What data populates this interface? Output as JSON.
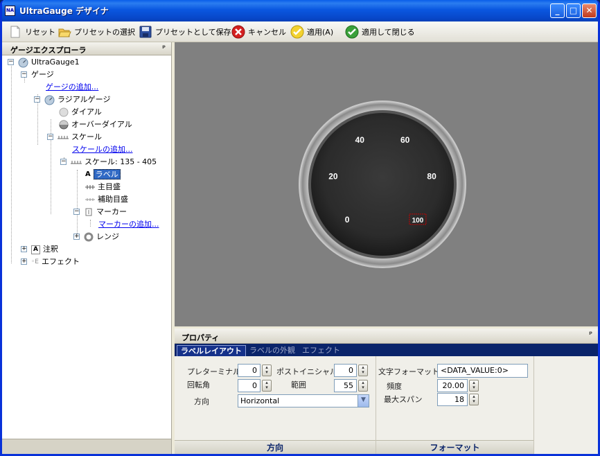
{
  "window": {
    "title": "UltraGauge デザイナ",
    "app_icon_text": "NA",
    "minimize": "_",
    "maximize": "□",
    "close": "✕"
  },
  "toolbar": {
    "reset": "リセット",
    "select_preset": "プリセットの選択",
    "save_as_preset": "プリセットとして保存",
    "cancel": "キャンセル",
    "apply": "適用(A)",
    "apply_close": "適用して閉じる"
  },
  "explorer": {
    "title": "ゲージエクスプローラ",
    "pin": "ᵖ",
    "nodes": {
      "root": "UltraGauge1",
      "gauges": "ゲージ",
      "add_gauge": "ゲージの追加...",
      "radial_gauge": "ラジアルゲージ",
      "dial": "ダイアル",
      "over_dial": "オーバーダイアル",
      "scales": "スケール",
      "add_scale": "スケールの追加...",
      "scale_item": "スケール: 135 - 405",
      "labels": "ラベル",
      "major_ticks": "主目盛",
      "minor_ticks": "補助目盛",
      "markers": "マーカー",
      "add_marker": "マーカーの追加...",
      "ranges": "レンジ",
      "annotations": "注釈",
      "effects": "エフェクト"
    }
  },
  "gauge": {
    "labels": [
      "0",
      "20",
      "40",
      "60",
      "80",
      "100"
    ],
    "values": [
      0,
      20,
      40,
      60,
      80,
      100
    ],
    "scale_start_angle": 135,
    "scale_end_angle": 405,
    "selected_label": "100"
  },
  "properties": {
    "title": "プロパティ",
    "pin": "ᵖ",
    "tabs": [
      "ラベルレイアウト",
      "ラベルの外観",
      "エフェクト"
    ],
    "active_tab": "ラベルレイアウト",
    "layout": {
      "preterminal_label": "プレターミナル",
      "preterminal_value": "0",
      "postinitial_label": "ポストイニシャル",
      "postinitial_value": "0",
      "rotation_label": "回転角",
      "rotation_value": "0",
      "range_label": "範囲",
      "range_value": "55",
      "orientation_label": "方向",
      "orientation_value": "Horizontal",
      "footer": "方向"
    },
    "format": {
      "format_label": "文字フォーマット",
      "format_value": "<DATA_VALUE:0>",
      "frequency_label": "頻度",
      "frequency_value": "20.00",
      "max_span_label": "最大スパン",
      "max_span_value": "18",
      "footer": "フォーマット"
    }
  },
  "colors": {
    "canvas_bg": "#808080",
    "gauge_face": "#2b2b2b",
    "label_text": "#ffffff",
    "selection": "#cc0000",
    "title_bar": "#0a57e0"
  }
}
